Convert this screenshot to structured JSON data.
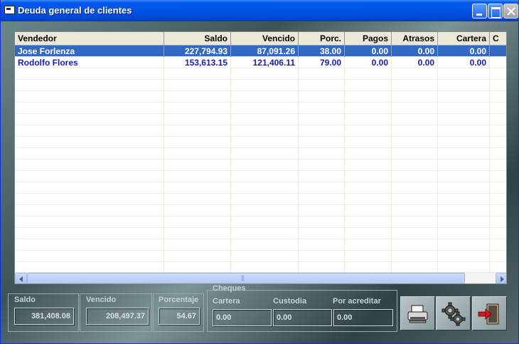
{
  "window": {
    "title": "Deuda general de clientes"
  },
  "grid": {
    "columns": [
      "Vendedor",
      "Saldo",
      "Vencido",
      "Porc.",
      "Pagos",
      "Atrasos",
      "Cartera",
      "C"
    ],
    "rows": [
      {
        "vendedor": "Jose Forlenza",
        "saldo": "227,794.93",
        "vencido": "87,091.26",
        "porc": "38.00",
        "pagos": "0.00",
        "atrasos": "0.00",
        "cartera": "0.00",
        "c": "",
        "selected": true
      },
      {
        "vendedor": "Rodolfo Flores",
        "saldo": "153,613.15",
        "vencido": "121,406.11",
        "porc": "79.00",
        "pagos": "0.00",
        "atrasos": "0.00",
        "cartera": "0.00",
        "c": "",
        "selected": false
      }
    ]
  },
  "totals": {
    "saldo_label": "Saldo",
    "saldo_value": "381,408.08",
    "vencido_label": "Vencido",
    "vencido_value": "208,497.37",
    "porcentaje_label": "Porcentaje",
    "porcentaje_value": "54.67"
  },
  "cheques": {
    "title": "Cheques",
    "cartera_label": "Cartera",
    "cartera_value": "0.00",
    "custodia_label": "Custodia",
    "custodia_value": "0.00",
    "por_acreditar_label": "Por acreditar",
    "por_acreditar_value": "0.00"
  },
  "actions": [
    {
      "icon": "printer-icon"
    },
    {
      "icon": "gears-icon"
    },
    {
      "icon": "exit-door-icon"
    }
  ],
  "colors": {
    "titlebar": "#0055e5",
    "selection": "#316ac5",
    "row_text": "#1a1ab0"
  }
}
